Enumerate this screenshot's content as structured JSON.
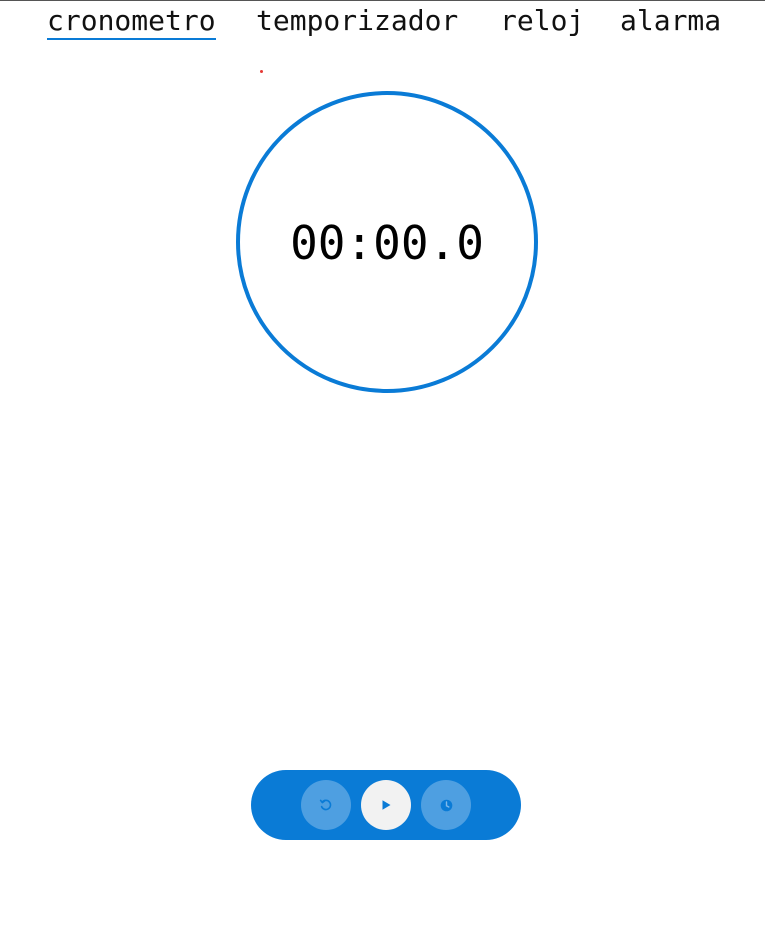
{
  "tabs": [
    {
      "label": "cronometro",
      "active": true
    },
    {
      "label": "temporizador",
      "active": false
    },
    {
      "label": "reloj",
      "active": false
    },
    {
      "label": "alarma",
      "active": false
    }
  ],
  "stopwatch": {
    "time": "00:00.0"
  },
  "controls": {
    "reset_icon": "reset-icon",
    "play_icon": "play-icon",
    "lap_icon": "clock-icon"
  },
  "colors": {
    "accent": "#0a7bd6",
    "red_marker": "#e53935"
  }
}
